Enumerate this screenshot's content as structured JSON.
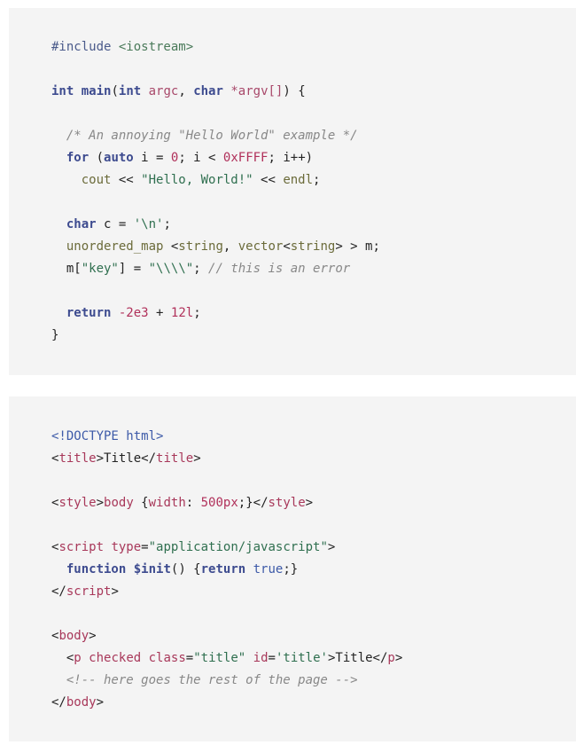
{
  "cpp": {
    "lines": [
      [
        [
          "pre",
          "#include "
        ],
        [
          "inc",
          "<iostream>"
        ]
      ],
      [],
      [
        [
          "kw",
          "int"
        ],
        [
          "plain",
          " "
        ],
        [
          "fn",
          "main"
        ],
        [
          "plain",
          "("
        ],
        [
          "kw",
          "int"
        ],
        [
          "plain",
          " "
        ],
        [
          "var",
          "argc"
        ],
        [
          "plain",
          ", "
        ],
        [
          "kw",
          "char"
        ],
        [
          "plain",
          " "
        ],
        [
          "var",
          "*argv[]"
        ],
        [
          "plain",
          ") {"
        ]
      ],
      [],
      [
        [
          "plain",
          "  "
        ],
        [
          "cm",
          "/* An annoying \"Hello World\" example */"
        ]
      ],
      [
        [
          "plain",
          "  "
        ],
        [
          "kw",
          "for"
        ],
        [
          "plain",
          " ("
        ],
        [
          "kw",
          "auto"
        ],
        [
          "plain",
          " i = "
        ],
        [
          "num",
          "0"
        ],
        [
          "plain",
          "; i < "
        ],
        [
          "num",
          "0xFFFF"
        ],
        [
          "plain",
          "; i++)"
        ]
      ],
      [
        [
          "plain",
          "    "
        ],
        [
          "typ",
          "cout"
        ],
        [
          "plain",
          " << "
        ],
        [
          "str",
          "\"Hello, World!\""
        ],
        [
          "plain",
          " << "
        ],
        [
          "typ",
          "endl"
        ],
        [
          "plain",
          ";"
        ]
      ],
      [],
      [
        [
          "plain",
          "  "
        ],
        [
          "kw",
          "char"
        ],
        [
          "plain",
          " c = "
        ],
        [
          "str",
          "'\\n'"
        ],
        [
          "plain",
          ";"
        ]
      ],
      [
        [
          "plain",
          "  "
        ],
        [
          "typ",
          "unordered_map"
        ],
        [
          "plain",
          " <"
        ],
        [
          "typ",
          "string"
        ],
        [
          "plain",
          ", "
        ],
        [
          "typ",
          "vector"
        ],
        [
          "plain",
          "<"
        ],
        [
          "typ",
          "string"
        ],
        [
          "plain",
          "> > m;"
        ]
      ],
      [
        [
          "plain",
          "  m["
        ],
        [
          "str",
          "\"key\""
        ],
        [
          "plain",
          "] = "
        ],
        [
          "str",
          "\"\\\\\\\\\""
        ],
        [
          "plain",
          "; "
        ],
        [
          "cm",
          "// this is an error"
        ]
      ],
      [],
      [
        [
          "plain",
          "  "
        ],
        [
          "kw",
          "return"
        ],
        [
          "plain",
          " "
        ],
        [
          "num",
          "-2e3"
        ],
        [
          "plain",
          " + "
        ],
        [
          "num",
          "12l"
        ],
        [
          "plain",
          ";"
        ]
      ],
      [
        [
          "plain",
          "}"
        ]
      ]
    ]
  },
  "html_code": {
    "lines": [
      [
        [
          "doc",
          "<!DOCTYPE html>"
        ]
      ],
      [
        [
          "plain",
          "<"
        ],
        [
          "tag",
          "title"
        ],
        [
          "plain",
          ">Title</"
        ],
        [
          "tag",
          "title"
        ],
        [
          "plain",
          ">"
        ]
      ],
      [],
      [
        [
          "plain",
          "<"
        ],
        [
          "tag",
          "style"
        ],
        [
          "plain",
          ">"
        ],
        [
          "css",
          "body"
        ],
        [
          "plain",
          " {"
        ],
        [
          "css",
          "width"
        ],
        [
          "plain",
          ": "
        ],
        [
          "num",
          "500px"
        ],
        [
          "plain",
          ";}</"
        ],
        [
          "tag",
          "style"
        ],
        [
          "plain",
          ">"
        ]
      ],
      [],
      [
        [
          "plain",
          "<"
        ],
        [
          "tag",
          "script"
        ],
        [
          "plain",
          " "
        ],
        [
          "attr",
          "type"
        ],
        [
          "plain",
          "="
        ],
        [
          "str",
          "\"application/javascript\""
        ],
        [
          "plain",
          ">"
        ]
      ],
      [
        [
          "plain",
          "  "
        ],
        [
          "kw",
          "function"
        ],
        [
          "plain",
          " "
        ],
        [
          "fn",
          "$init"
        ],
        [
          "plain",
          "() {"
        ],
        [
          "kw",
          "return"
        ],
        [
          "plain",
          " "
        ],
        [
          "lit",
          "true"
        ],
        [
          "plain",
          ";}"
        ]
      ],
      [
        [
          "plain",
          "</"
        ],
        [
          "tag",
          "script"
        ],
        [
          "plain",
          ">"
        ]
      ],
      [],
      [
        [
          "plain",
          "<"
        ],
        [
          "tag",
          "body"
        ],
        [
          "plain",
          ">"
        ]
      ],
      [
        [
          "plain",
          "  <"
        ],
        [
          "tag",
          "p"
        ],
        [
          "plain",
          " "
        ],
        [
          "attr",
          "checked"
        ],
        [
          "plain",
          " "
        ],
        [
          "attr",
          "class"
        ],
        [
          "plain",
          "="
        ],
        [
          "str",
          "\"title\""
        ],
        [
          "plain",
          " "
        ],
        [
          "attr",
          "id"
        ],
        [
          "plain",
          "="
        ],
        [
          "str",
          "'title'"
        ],
        [
          "plain",
          ">Title</"
        ],
        [
          "tag",
          "p"
        ],
        [
          "plain",
          ">"
        ]
      ],
      [
        [
          "plain",
          "  "
        ],
        [
          "cm",
          "<!-- here goes the rest of the page -->"
        ]
      ],
      [
        [
          "plain",
          "</"
        ],
        [
          "tag",
          "body"
        ],
        [
          "plain",
          ">"
        ]
      ]
    ]
  }
}
